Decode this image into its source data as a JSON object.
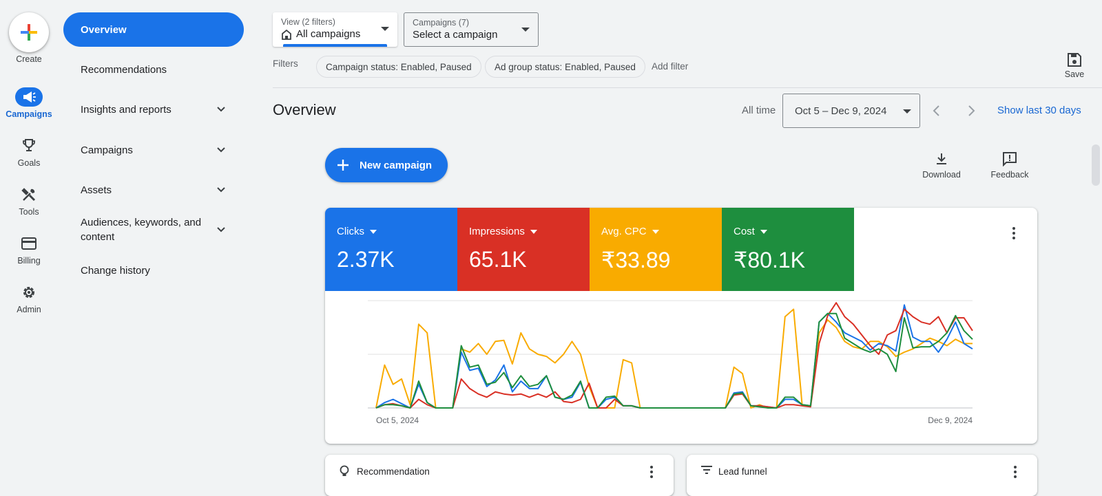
{
  "rail": {
    "create_label": "Create",
    "items": [
      {
        "label": "Campaigns",
        "icon": "megaphone-icon",
        "active": true
      },
      {
        "label": "Goals",
        "icon": "trophy-icon"
      },
      {
        "label": "Tools",
        "icon": "tools-icon"
      },
      {
        "label": "Billing",
        "icon": "credit-card-icon"
      },
      {
        "label": "Admin",
        "icon": "gear-icon"
      }
    ]
  },
  "nav": {
    "items": [
      {
        "label": "Overview",
        "active": true
      },
      {
        "label": "Recommendations"
      },
      {
        "label": "Insights and reports",
        "expandable": true
      },
      {
        "label": "Campaigns",
        "expandable": true
      },
      {
        "label": "Assets",
        "expandable": true
      },
      {
        "label": "Audiences, keywords, and content",
        "expandable": true
      },
      {
        "label": "Change history"
      }
    ]
  },
  "header": {
    "view_dropdown": {
      "small": "View (2 filters)",
      "value": "All campaigns"
    },
    "campaign_dropdown": {
      "small": "Campaigns (7)",
      "value": "Select a campaign"
    },
    "filters_label": "Filters",
    "chips": [
      "Campaign status: Enabled, Paused",
      "Ad group status: Enabled, Paused"
    ],
    "add_filter": "Add filter",
    "save_label": "Save"
  },
  "overview": {
    "title": "Overview",
    "all_time": "All time",
    "date_range": "Oct 5 – Dec 9, 2024",
    "show_last": "Show last 30 days",
    "new_campaign": "New campaign",
    "download": "Download",
    "feedback": "Feedback"
  },
  "metrics": [
    {
      "name": "Clicks",
      "value": "2.37K",
      "color": "#1a73e8"
    },
    {
      "name": "Impressions",
      "value": "65.1K",
      "color": "#d93025"
    },
    {
      "name": "Avg. CPC",
      "value": "₹33.89",
      "color": "#f9ab00"
    },
    {
      "name": "Cost",
      "value": "₹80.1K",
      "color": "#1e8e3e"
    }
  ],
  "chart_data": {
    "type": "line",
    "x_start_label": "Oct 5, 2024",
    "x_end_label": "Dec 9, 2024",
    "grid": true,
    "ylim": [
      0,
      100
    ],
    "series": [
      {
        "color": "#f9ab00",
        "values": [
          0,
          40,
          22,
          27,
          3,
          78,
          70,
          0,
          0,
          0,
          55,
          52,
          60,
          50,
          62,
          63,
          41,
          70,
          55,
          50,
          48,
          42,
          50,
          62,
          50,
          20,
          0,
          0,
          0,
          45,
          42,
          0,
          0,
          0,
          0,
          0,
          0,
          0,
          0,
          0,
          0,
          0,
          38,
          32,
          0,
          3,
          0,
          0,
          85,
          92,
          3,
          2,
          70,
          82,
          75,
          62,
          57,
          55,
          62,
          62,
          57,
          48,
          52,
          55,
          60,
          65,
          62,
          58,
          64,
          60,
          60
        ]
      },
      {
        "color": "#1a73e8",
        "values": [
          0,
          5,
          8,
          4,
          0,
          22,
          5,
          0,
          0,
          0,
          52,
          35,
          37,
          20,
          26,
          40,
          15,
          25,
          18,
          18,
          30,
          10,
          8,
          10,
          24,
          0,
          0,
          8,
          10,
          2,
          2,
          0,
          0,
          0,
          0,
          0,
          0,
          0,
          0,
          0,
          0,
          0,
          14,
          15,
          2,
          2,
          1,
          0,
          8,
          8,
          3,
          2,
          80,
          88,
          80,
          70,
          66,
          62,
          54,
          60,
          58,
          53,
          96,
          66,
          62,
          62,
          52,
          64,
          80,
          60,
          55
        ]
      },
      {
        "color": "#d93025",
        "values": [
          0,
          3,
          4,
          2,
          0,
          8,
          3,
          0,
          0,
          0,
          27,
          18,
          13,
          10,
          15,
          13,
          12,
          13,
          10,
          13,
          10,
          15,
          6,
          5,
          8,
          23,
          0,
          0,
          8,
          2,
          2,
          0,
          0,
          0,
          0,
          0,
          0,
          0,
          0,
          0,
          0,
          0,
          12,
          13,
          2,
          2,
          1,
          0,
          3,
          3,
          2,
          1,
          60,
          86,
          98,
          85,
          78,
          68,
          58,
          50,
          68,
          72,
          92,
          85,
          80,
          78,
          85,
          70,
          84,
          84,
          72
        ]
      },
      {
        "color": "#1e8e3e",
        "values": [
          0,
          3,
          3,
          2,
          0,
          25,
          5,
          0,
          0,
          0,
          58,
          38,
          40,
          22,
          24,
          33,
          19,
          30,
          20,
          22,
          30,
          10,
          8,
          12,
          25,
          0,
          0,
          10,
          11,
          2,
          2,
          0,
          0,
          0,
          0,
          0,
          0,
          0,
          0,
          0,
          0,
          0,
          13,
          14,
          2,
          1,
          0,
          0,
          10,
          10,
          3,
          2,
          80,
          88,
          88,
          65,
          60,
          55,
          52,
          55,
          50,
          34,
          84,
          56,
          57,
          57,
          62,
          70,
          86,
          72,
          64
        ]
      }
    ]
  },
  "bottom_cards": [
    {
      "title": "Recommendation",
      "icon": "lightbulb-icon"
    },
    {
      "title": "Lead funnel",
      "icon": "filter-icon"
    }
  ]
}
